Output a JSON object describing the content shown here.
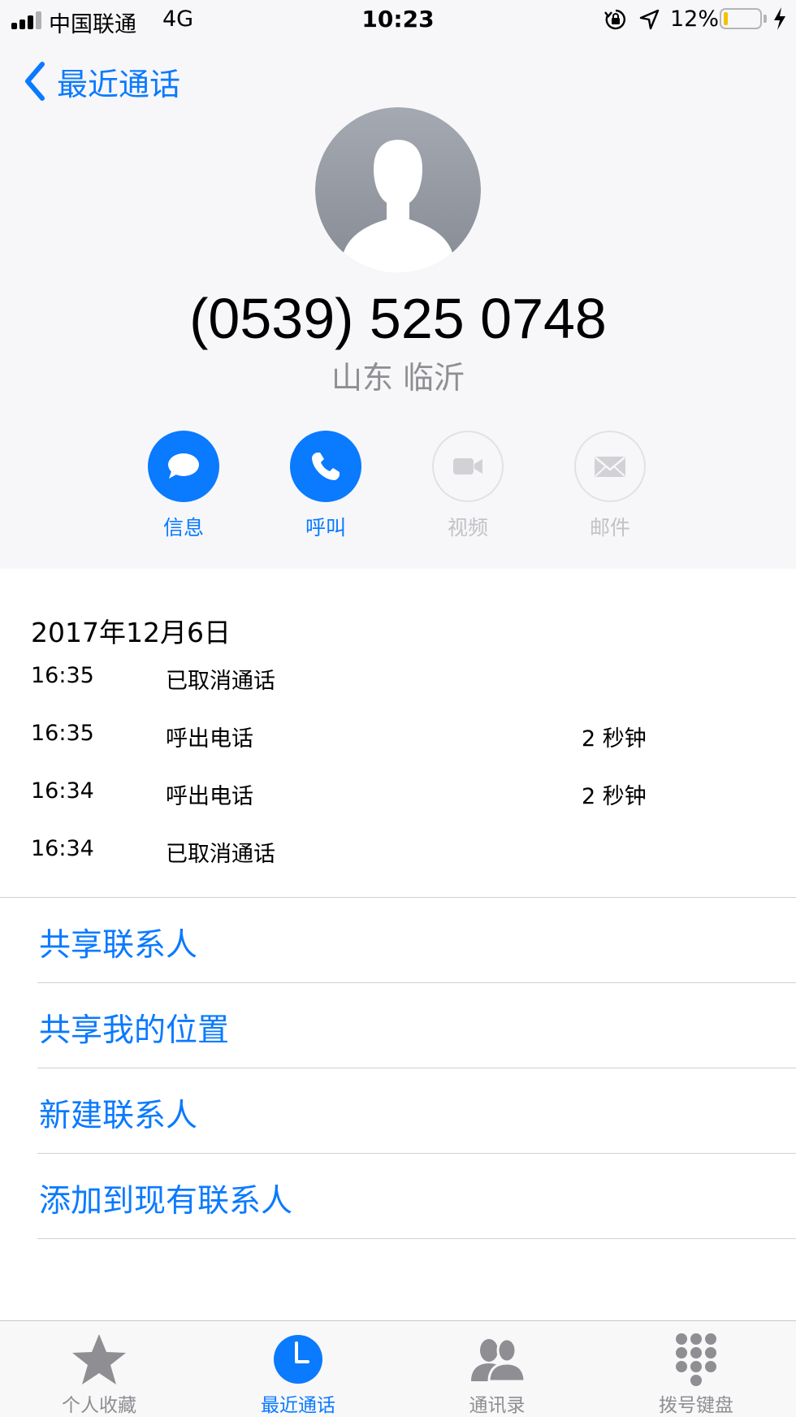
{
  "status_bar": {
    "carrier": "中国联通",
    "network": "4G",
    "time": "10:23",
    "battery_percent": "12%",
    "battery_level": 0.12
  },
  "nav": {
    "back_label": "最近通话",
    "back_icon": "chevron-left-icon"
  },
  "contact": {
    "phone_number": "(0539) 525 0748",
    "location": "山东 临沂",
    "avatar_icon": "person-silhouette-icon"
  },
  "actions": [
    {
      "label": "信息",
      "icon": "message-icon",
      "enabled": true
    },
    {
      "label": "呼叫",
      "icon": "phone-icon",
      "enabled": true
    },
    {
      "label": "视频",
      "icon": "video-icon",
      "enabled": false
    },
    {
      "label": "邮件",
      "icon": "mail-icon",
      "enabled": false
    }
  ],
  "history": {
    "date": "2017年12月6日",
    "calls": [
      {
        "time": "16:35",
        "type": "已取消通话",
        "duration": ""
      },
      {
        "time": "16:35",
        "type": "呼出电话",
        "duration": "2 秒钟"
      },
      {
        "time": "16:34",
        "type": "呼出电话",
        "duration": "2 秒钟"
      },
      {
        "time": "16:34",
        "type": "已取消通话",
        "duration": ""
      }
    ]
  },
  "options": [
    {
      "label": "共享联系人"
    },
    {
      "label": "共享我的位置"
    },
    {
      "label": "新建联系人"
    },
    {
      "label": "添加到现有联系人"
    }
  ],
  "tabs": [
    {
      "label": "个人收藏",
      "icon": "star-icon",
      "active": false
    },
    {
      "label": "最近通话",
      "icon": "clock-icon",
      "active": true
    },
    {
      "label": "通讯录",
      "icon": "contacts-icon",
      "active": false
    },
    {
      "label": "拨号键盘",
      "icon": "keypad-icon",
      "active": false
    }
  ],
  "colors": {
    "accent": "#0a7aff",
    "disabled": "#c2c2c7",
    "secondary_text": "#8e8e93",
    "battery_low": "#f2c200"
  }
}
